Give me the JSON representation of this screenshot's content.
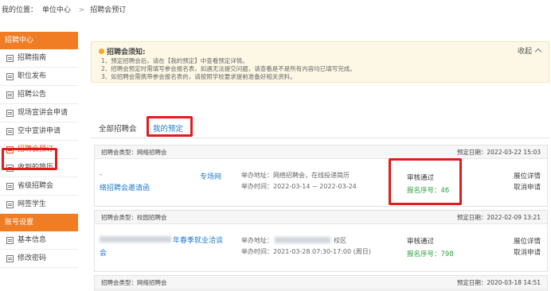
{
  "breadcrumb": {
    "prefix": "我的位置：",
    "items": [
      "单位中心",
      "招聘会预订"
    ]
  },
  "sidebar": {
    "section1": "招聘中心",
    "items1": [
      "招聘指南",
      "职位发布",
      "招聘公告",
      "现场宣讲会申请",
      "空中宣讲申请",
      "招聘会预订",
      "收到的简历",
      "省级招聘会",
      "网签学生"
    ],
    "active_index": 5,
    "section2": "账号设置",
    "items2": [
      "基本信息",
      "修改密码"
    ]
  },
  "notice": {
    "title": "招聘会须知:",
    "collapse_label": "收起",
    "lines": [
      "1、预定招聘会后，请在【我的预定】中查看预定详情。",
      "2、招聘会预定时需填写参会报名表，如遇无法提交问题，请查看是不是所有内容均已填写完成。",
      "3、如招聘会需携带参会报名表的，请按照学校要求提前准备好相关资料。"
    ]
  },
  "tabs": [
    "全部招聘会",
    "我的预定"
  ],
  "active_tab": 1,
  "cards": [
    {
      "type": "招聘会类型：网络招聘会",
      "date": "预定日期：2022-03-22 15:03",
      "title_tag": "专场网",
      "title": "络招聘会邀请函",
      "address": "举办地址：网络招聘会，在线投递简历",
      "time": "举办时间：2022-03-14 ~ 2022-03-24",
      "status": "审核通过",
      "seq": "报名序号：46",
      "links": [
        "展位详情",
        "取消申请"
      ]
    },
    {
      "type": "招聘会类型：校园招聘会",
      "date": "预定日期：2022-02-09 13:21",
      "title_tag": "年春季就业洽谈",
      "title": "会",
      "address_prefix": "举办地址：",
      "address_suffix": "校区",
      "time": "举办时间：2021-03-28 07:30-17:00 (周日)",
      "status": "审核通过",
      "seq": "报名序号：798",
      "links": [
        "展位详情",
        "取消申请"
      ]
    },
    {
      "type": "招聘会类型：网络招聘会",
      "date": "预定日期：2020-03-18 14:51"
    }
  ],
  "colors": {
    "accent_orange": "#f07c24",
    "link_blue": "#1f7ac9",
    "success_green": "#2ea33f",
    "highlight_red": "#e01c1c"
  }
}
